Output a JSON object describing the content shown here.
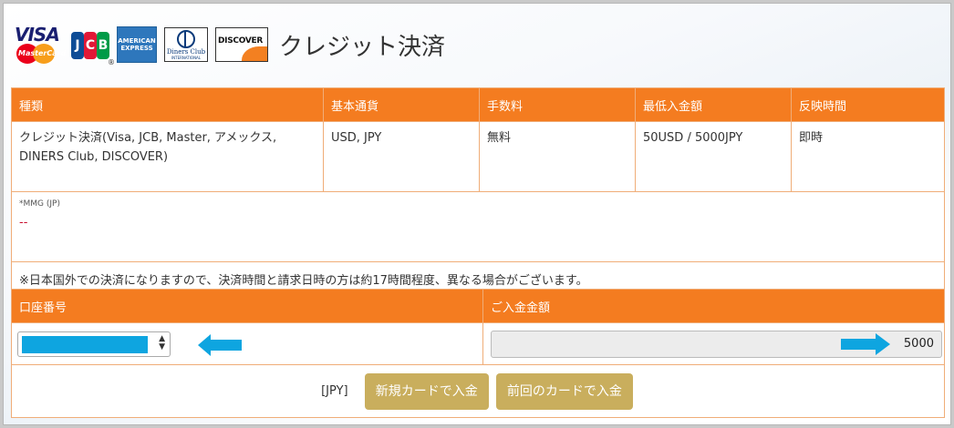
{
  "header": {
    "title": "クレジット決済",
    "logos": {
      "visa": "VISA",
      "mastercard": "MasterCard",
      "jcb": "JCB",
      "amex": [
        "AMERICAN",
        "EXPRESS"
      ],
      "diners_top": "Diners Club",
      "diners_bottom": "INTERNATIONAL",
      "discover": "DISCOVER"
    }
  },
  "info_table": {
    "headers": [
      "種類",
      "基本通貨",
      "手数料",
      "最低入金額",
      "反映時間"
    ],
    "row": {
      "type_line1": "クレジット決済(Visa, JCB, Master, アメックス,",
      "type_line2": "DINERS Club, DISCOVER)",
      "currency": "USD, JPY",
      "fee": "無料",
      "minimum": "50USD / 5000JPY",
      "time": "即時"
    },
    "mmg_label": "*MMG (JP)",
    "mmg_value": "--",
    "note": "※日本国外での決済になりますので、決済時間と請求日時の方は約17時間程度、異なる場合がございます。"
  },
  "deposit_form": {
    "account_header": "口座番号",
    "amount_header": "ご入金金額",
    "amount_value": "5000",
    "currency_label": "[JPY]",
    "new_card_button": "新規カードで入金",
    "previous_card_button": "前回のカードで入金"
  },
  "colors": {
    "header_orange": "#f47c20",
    "button_gold": "#c9ae5d",
    "highlight_blue": "#0ea5e0"
  }
}
